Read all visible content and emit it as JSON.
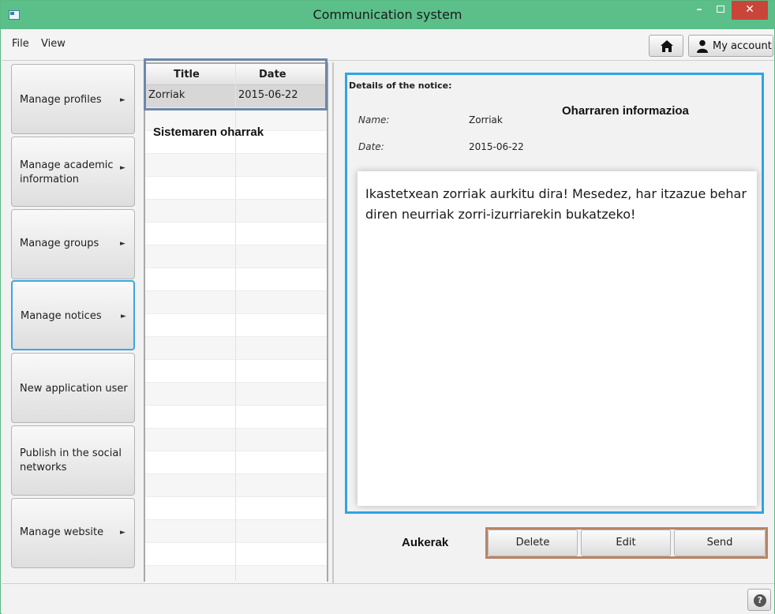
{
  "window": {
    "title": "Communication system"
  },
  "menubar": {
    "file": "File",
    "view": "View",
    "account_label": "My account"
  },
  "sidebar": {
    "items": [
      {
        "label": "Manage profiles",
        "arrow": "►"
      },
      {
        "label": "Manage academic information",
        "arrow": "►"
      },
      {
        "label": "Manage groups",
        "arrow": "►"
      },
      {
        "label": "Manage notices",
        "arrow": "►"
      },
      {
        "label": "New application user",
        "arrow": ""
      },
      {
        "label": "Publish in the social networks",
        "arrow": ""
      },
      {
        "label": "Manage website",
        "arrow": "►"
      }
    ]
  },
  "notices_table": {
    "columns": [
      "Title",
      "Date"
    ],
    "rows": [
      {
        "title": "Zorriak",
        "date": "2015-06-22"
      }
    ],
    "caption": "Sistemaren oharrak"
  },
  "details": {
    "heading": "Details of the notice:",
    "caption": "Oharraren informazioa",
    "name_label": "Name:",
    "name_value": "Zorriak",
    "date_label": "Date:",
    "date_value": "2015-06-22",
    "message": "Ikastetxean zorriak aurkitu dira! Mesedez, har itzazue behar diren neurriak zorri-izurriarekin bukatzeko!"
  },
  "options": {
    "caption": "Aukerak",
    "delete": "Delete",
    "edit": "Edit",
    "send": "Send"
  },
  "statusbar": {
    "help": "?"
  },
  "colors": {
    "titlebar": "#5bbf8a",
    "close": "#c9453a",
    "selection_frame": "#6d87a9",
    "details_frame": "#2ea4e6",
    "options_frame": "#b98463",
    "active_border": "#3ca6e2"
  }
}
